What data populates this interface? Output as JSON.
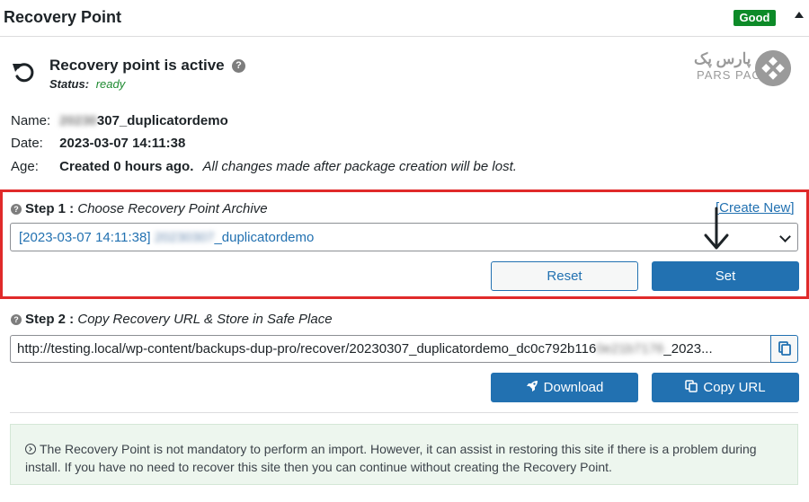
{
  "header": {
    "title": "Recovery Point",
    "badge": "Good"
  },
  "active": {
    "title": "Recovery point is active",
    "status_label": "Status:",
    "status_value": "ready"
  },
  "logo": {
    "text_top": "پارس پک",
    "text_bottom": "PARS PACK"
  },
  "info": {
    "name_label": "Name:",
    "name_blur": "20230",
    "name_value": "307_duplicatordemo",
    "date_label": "Date:",
    "date_value": "2023-03-07 14:11:38",
    "age_label": "Age:",
    "age_value": "Created 0 hours ago.",
    "age_note": "All changes made after package creation will be lost."
  },
  "step1": {
    "label": "Step 1 :",
    "title": "Choose Recovery Point Archive",
    "create_new": "[Create New]",
    "selected_prefix": "[2023-03-07 14:11:38]",
    "selected_blur": "20230307",
    "selected_suffix": "_duplicatordemo",
    "reset_label": "Reset",
    "set_label": "Set"
  },
  "step2": {
    "label": "Step 2 :",
    "title": "Copy Recovery URL & Store in Safe Place",
    "url_prefix": "http://testing.local/wp-content/backups-dup-pro/recover/20230307_duplicatordemo_dc0c792b116",
    "url_blur": "0e21b7176",
    "url_suffix": "_2023...",
    "download_label": "Download",
    "copy_label": "Copy URL"
  },
  "notice": {
    "text": "The Recovery Point is not mandatory to perform an import. However, it can assist in restoring this site if there is a problem during install. If you have no need to recover this site then you can continue without creating the Recovery Point."
  },
  "colors": {
    "accent": "#2271b1",
    "good_badge": "#0d8a28",
    "highlight_border": "#e02a2a",
    "notice_bg": "#edf6ee",
    "status_ready": "#1e8a30"
  }
}
